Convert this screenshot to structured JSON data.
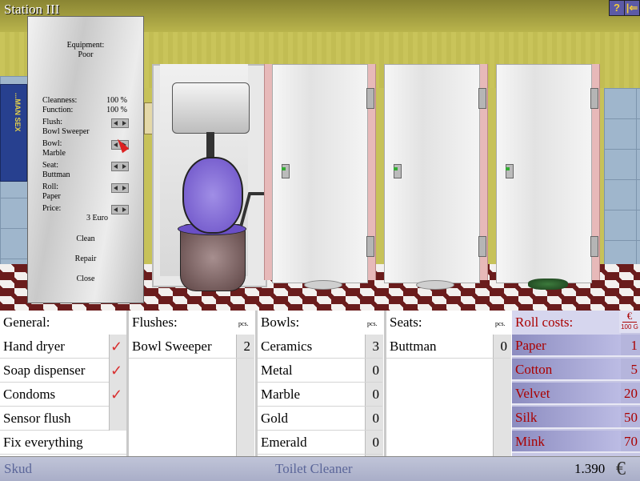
{
  "window": {
    "title": "Station III",
    "help_label": "?",
    "exit_label": "|⇐"
  },
  "scene": {
    "poster_text": "...MAN SEX"
  },
  "panel": {
    "equipment_label": "Equipment:",
    "equipment_value": "Poor",
    "cleanness_label": "Cleanness:",
    "cleanness_value": "100 %",
    "function_label": "Function:",
    "function_value": "100 %",
    "flush_label": "Flush:",
    "flush_value": "Bowl Sweeper",
    "bowl_label": "Bowl:",
    "bowl_value": "Marble",
    "seat_label": "Seat:",
    "seat_value": "Buttman",
    "roll_label": "Roll:",
    "roll_value": "Paper",
    "price_label": "Price:",
    "price_value": "3 Euro",
    "clean_label": "Clean",
    "repair_label": "Repair",
    "close_label": "Close"
  },
  "general": {
    "header": "General:",
    "items": [
      {
        "label": "Hand dryer",
        "check": "✓"
      },
      {
        "label": "Soap dispenser",
        "check": "✓"
      },
      {
        "label": "Condoms",
        "check": "✓"
      },
      {
        "label": "Sensor flush",
        "check": ""
      },
      {
        "label": "Fix everything",
        "check": ""
      }
    ]
  },
  "flushes": {
    "header": "Flushes:",
    "pcs": "pcs.",
    "items": [
      {
        "label": "Bowl Sweeper",
        "qty": "2"
      }
    ]
  },
  "bowls": {
    "header": "Bowls:",
    "pcs": "pcs.",
    "items": [
      {
        "label": "Ceramics",
        "qty": "3"
      },
      {
        "label": "Metal",
        "qty": "0"
      },
      {
        "label": "Marble",
        "qty": "0"
      },
      {
        "label": "Gold",
        "qty": "0"
      },
      {
        "label": "Emerald",
        "qty": "0"
      }
    ]
  },
  "seats": {
    "header": "Seats:",
    "pcs": "pcs.",
    "items": [
      {
        "label": "Buttman",
        "qty": "0"
      }
    ]
  },
  "rolls": {
    "header": "Roll costs:",
    "euro_symbol": "€",
    "unit": "100 G",
    "items": [
      {
        "label": "Paper",
        "cost": "1"
      },
      {
        "label": "Cotton",
        "cost": "5"
      },
      {
        "label": "Velvet",
        "cost": "20"
      },
      {
        "label": "Silk",
        "cost": "50"
      },
      {
        "label": "Mink",
        "cost": "70"
      }
    ]
  },
  "status": {
    "player": "Skud",
    "rank": "Toilet Cleaner",
    "money": "1.390",
    "currency": "€"
  }
}
